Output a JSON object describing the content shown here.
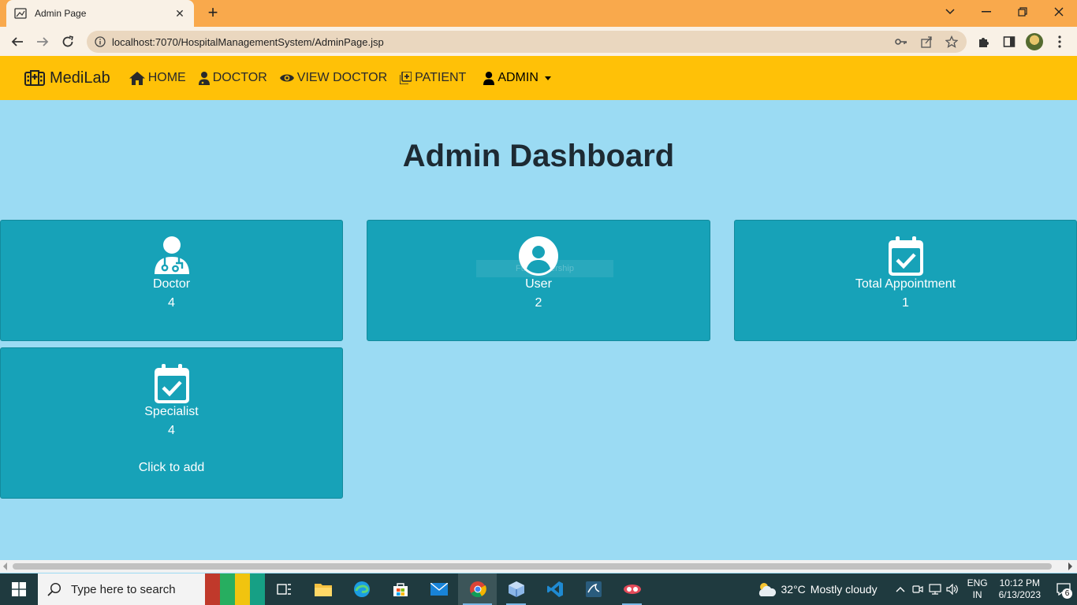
{
  "browser": {
    "tab_title": "Admin Page",
    "tab_close": "✕",
    "new_tab": "+",
    "url": "localhost:7070/HospitalManagementSystem/AdminPage.jsp"
  },
  "navbar": {
    "brand": "MediLab",
    "links": [
      {
        "label": "HOME",
        "icon": "home-icon"
      },
      {
        "label": "DOCTOR",
        "icon": "user-doctor-icon"
      },
      {
        "label": "VIEW DOCTOR",
        "icon": "eye-icon"
      },
      {
        "label": "PATIENT",
        "icon": "notes-medical-icon"
      }
    ],
    "admin_label": "ADMIN"
  },
  "main": {
    "title": "Admin Dashboard",
    "cards": [
      {
        "label": "Doctor",
        "value": "4",
        "icon": "doctor-icon"
      },
      {
        "label": "User",
        "value": "2",
        "icon": "user-circle-icon",
        "tooltip": "Full-Ownership"
      },
      {
        "label": "Total Appointment",
        "value": "1",
        "icon": "calendar-check-icon"
      },
      {
        "label": "Specialist",
        "value": "4",
        "icon": "calendar-check-icon",
        "action": "Click to add"
      }
    ]
  },
  "taskbar": {
    "search_placeholder": "Type here to search",
    "weather_temp": "32°C",
    "weather_desc": "Mostly cloudy",
    "lang_1": "ENG",
    "lang_2": "IN",
    "time": "10:12 PM",
    "date": "6/13/2023",
    "notification_count": "6"
  },
  "colors": {
    "tabbar": "#f9a94c",
    "navbar": "#ffc107",
    "page_bg": "#9bdbf3",
    "card_bg": "#17a2b8",
    "taskbar": "#1f3a3f"
  }
}
